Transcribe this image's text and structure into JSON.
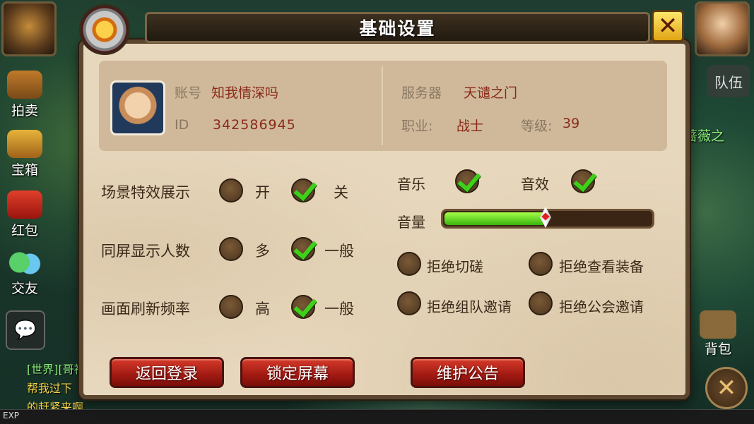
{
  "dialog": {
    "title": "基础设置",
    "close_label": "✕"
  },
  "profile": {
    "account_label": "账号",
    "account_value": "知我情深吗",
    "id_label": "ID",
    "id_value": "342586945",
    "server_label": "服务器",
    "server_value": "天谴之门",
    "class_label": "职业:",
    "class_value": "战士",
    "level_label": "等级:",
    "level_value": "39"
  },
  "display_settings": [
    {
      "label": "场景特效展示",
      "options": [
        {
          "text": "开",
          "checked": false
        },
        {
          "text": "关",
          "checked": true
        }
      ]
    },
    {
      "label": "同屏显示人数",
      "options": [
        {
          "text": "多",
          "checked": false
        },
        {
          "text": "一般",
          "checked": true
        }
      ]
    },
    {
      "label": "画面刷新频率",
      "options": [
        {
          "text": "高",
          "checked": false
        },
        {
          "text": "一般",
          "checked": true
        }
      ]
    }
  ],
  "audio": {
    "music_label": "音乐",
    "music_checked": true,
    "sfx_label": "音效",
    "sfx_checked": true,
    "volume_label": "音量",
    "volume_fraction": 0.49
  },
  "privacy": [
    {
      "label": "拒绝切磋",
      "checked": false
    },
    {
      "label": "拒绝查看装备",
      "checked": false
    },
    {
      "label": "拒绝组队邀请",
      "checked": false
    },
    {
      "label": "拒绝公会邀请",
      "checked": false
    }
  ],
  "buttons": {
    "back_login": "返回登录",
    "lock_screen": "锁定屏幕",
    "maintenance": "维护公告"
  },
  "hud": {
    "auction": "拍卖",
    "treasure": "宝箱",
    "red_packet": "红包",
    "friends": "交友",
    "team": "队伍",
    "guild_name": "蔷薇之",
    "bag": "背包",
    "exp": "EXP",
    "chat_line1": "[世界][哥神",
    "chat_line2": "帮我过下",
    "chat_line3": "的赶紧来啊."
  }
}
